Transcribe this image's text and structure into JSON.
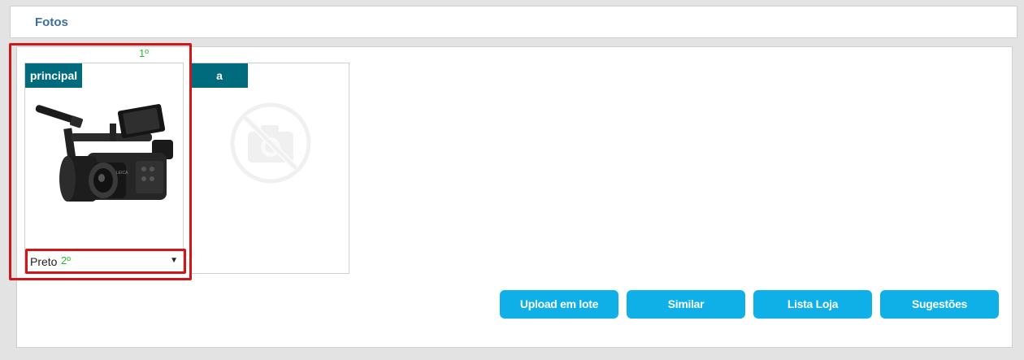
{
  "header": {
    "title": "Fotos"
  },
  "cards": [
    {
      "tag": "principal",
      "image": "camcorder-photo",
      "select_value": "Preto"
    },
    {
      "tag": "a",
      "image": "no-photo-icon"
    }
  ],
  "annotations": {
    "first": "1º",
    "second": "2º"
  },
  "buttons": {
    "upload": "Upload em lote",
    "similar": "Similar",
    "lista": "Lista Loja",
    "sugestoes": "Sugestões"
  },
  "colors": {
    "tag_bg": "#006b7d",
    "button_bg": "#0fb0e8",
    "highlight_red": "#d01616",
    "annotation_green": "#2ab934",
    "header_title": "#3d6e9c"
  }
}
